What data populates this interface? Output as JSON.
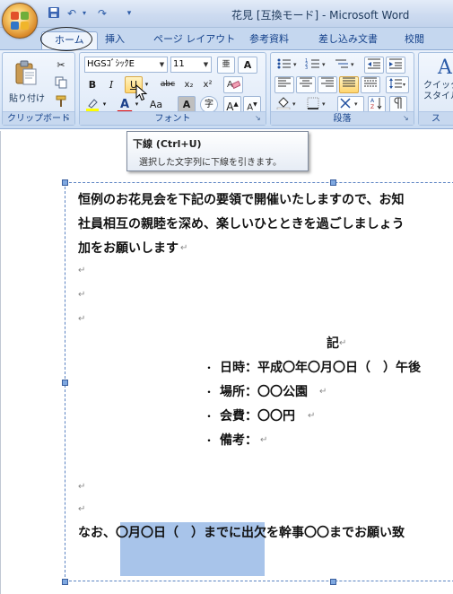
{
  "window": {
    "title": "花見 [互換モード] - Microsoft Word"
  },
  "tabs": [
    "ホーム",
    "挿入",
    "ページ レイアウト",
    "参考資料",
    "差し込み文書",
    "校閲"
  ],
  "ribbon": {
    "clipboard": {
      "paste_label": "貼り付け",
      "group_label": "クリップボード"
    },
    "font": {
      "font_name": "HGSｺﾞｼｯｸE",
      "font_size": "11",
      "group_label": "フォント",
      "bold": "B",
      "italic": "I",
      "underline": "U",
      "strike": "abc",
      "subscript": "x₂",
      "superscript": "x²",
      "font_color": "A",
      "case": "Aa",
      "char_shading": "A",
      "enclose": "字",
      "grow": "A",
      "shrink": "A",
      "clear": "A",
      "phonetic": "亜"
    },
    "paragraph": {
      "group_label": "段落"
    },
    "styles": {
      "quick_label_line1": "クイック",
      "quick_label_line2": "スタイル",
      "group_label": "ス"
    }
  },
  "tooltip": {
    "title": "下線 (Ctrl+U)",
    "description": "選択した文字列に下線を引きます。"
  },
  "document": {
    "lines": [
      "恒例のお花見会を下記の要領で開催いたしますので、お知",
      "社員相互の親睦を深め、楽しいひとときを過ごしましょう",
      "加をお願いします"
    ],
    "heading": "記",
    "items": [
      "日時：平成〇年〇月〇日（　）午後",
      "場所：〇〇公園",
      "会費：〇〇円",
      "備考："
    ],
    "footer_line": "なお、〇月〇日（　）までに出欠を幹事〇〇までお願い致",
    "paragraph_mark": "↵",
    "bullet": "・"
  },
  "colors": {
    "ribbon": "#dde8f7",
    "tab_text": "#15428b",
    "selection": "#a8c4ea",
    "underline_hot": "#ffd66f"
  }
}
